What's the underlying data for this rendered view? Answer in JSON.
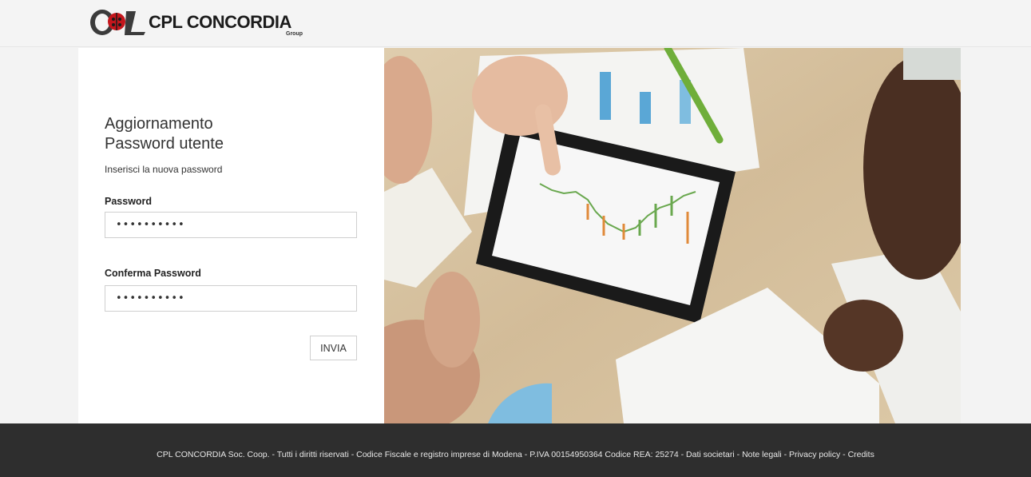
{
  "header": {
    "brand": "CPL CONCORDIA",
    "brand_sub": "Group",
    "logo_icon": "cpl-ladybug-logo"
  },
  "form": {
    "title_line1": "Aggiornamento",
    "title_line2": "Password utente",
    "subtitle": "Inserisci la nuova password",
    "password_label": "Password",
    "password_value": "••••••••••",
    "confirm_label": "Conferma Password",
    "confirm_value": "••••••••••",
    "submit_label": "INVIA"
  },
  "footer": {
    "company": "CPL CONCORDIA Soc. Coop.",
    "rights": "Tutti i diritti riservati",
    "registry": "Codice Fiscale e registro imprese di Modena",
    "vat": "P.IVA 00154950364 Codice REA: 25274",
    "sep": " - ",
    "links": [
      "Dati societari",
      "Note legali",
      "Privacy policy",
      "Credits"
    ]
  },
  "colors": {
    "footer_bg": "#2e2e2e",
    "panel_bg": "#ffffff",
    "page_bg": "#f3f3f3"
  }
}
